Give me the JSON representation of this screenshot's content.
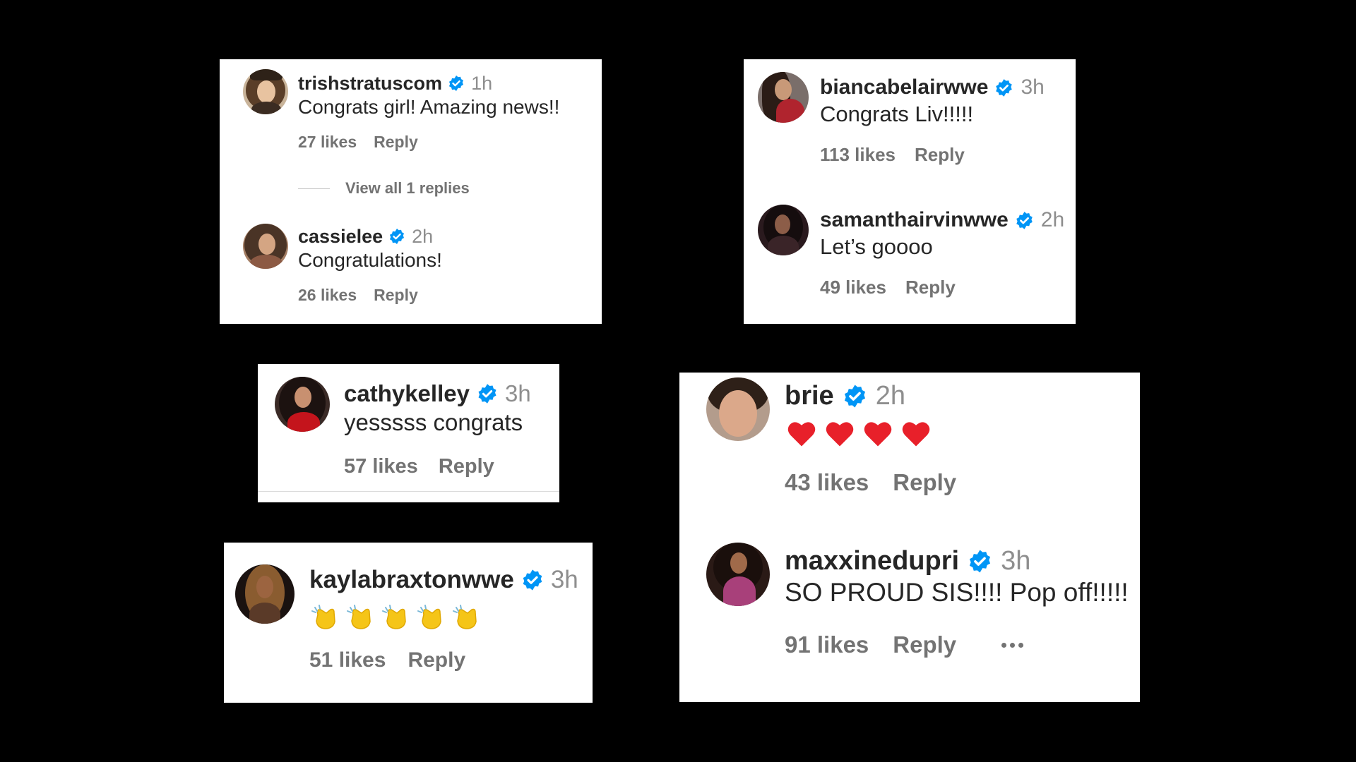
{
  "colors": {
    "background": "#000000",
    "card": "#ffffff",
    "username": "#262626",
    "meta": "#737373",
    "verified_badge": "#0095f6",
    "heart": "#e0245e",
    "clap": "#f5c518"
  },
  "icons": {
    "verified": "verified-badge-icon",
    "heart": "red-heart-emoji",
    "clap": "clapping-hands-emoji",
    "more": "more-options-icon"
  },
  "cards": {
    "trish_card": {
      "c1": {
        "username": "trishstratuscom",
        "time": "1h",
        "text": "Congrats girl! Amazing news!!",
        "likes": "27 likes",
        "reply": "Reply",
        "view_replies": "View all 1 replies"
      },
      "c2": {
        "username": "cassielee",
        "time": "2h",
        "text": "Congratulations!",
        "likes": "26 likes",
        "reply": "Reply"
      }
    },
    "bianca_card": {
      "c1": {
        "username": "biancabelairwwe",
        "time": "3h",
        "text": "Congrats Liv!!!!!",
        "likes": "113 likes",
        "reply": "Reply"
      },
      "c2": {
        "username": "samanthairvinwwe",
        "time": "2h",
        "text": "Let’s goooo",
        "likes": "49 likes",
        "reply": "Reply"
      }
    },
    "cathy_card": {
      "c1": {
        "username": "cathykelley",
        "time": "3h",
        "text": "yesssss congrats",
        "likes": "57 likes",
        "reply": "Reply"
      }
    },
    "kayla_card": {
      "c1": {
        "username": "kaylabraxtonwwe",
        "time": "3h",
        "emoji": [
          "clap",
          "clap",
          "clap",
          "clap",
          "clap"
        ],
        "likes": "51 likes",
        "reply": "Reply"
      }
    },
    "brie_card": {
      "c1": {
        "username": "brie",
        "time": "2h",
        "emoji": [
          "heart",
          "heart",
          "heart",
          "heart"
        ],
        "likes": "43 likes",
        "reply": "Reply"
      },
      "c2": {
        "username": "maxxinedupri",
        "time": "3h",
        "text": "SO PROUD SIS!!!! Pop off!!!!!",
        "likes": "91 likes",
        "reply": "Reply"
      }
    }
  }
}
